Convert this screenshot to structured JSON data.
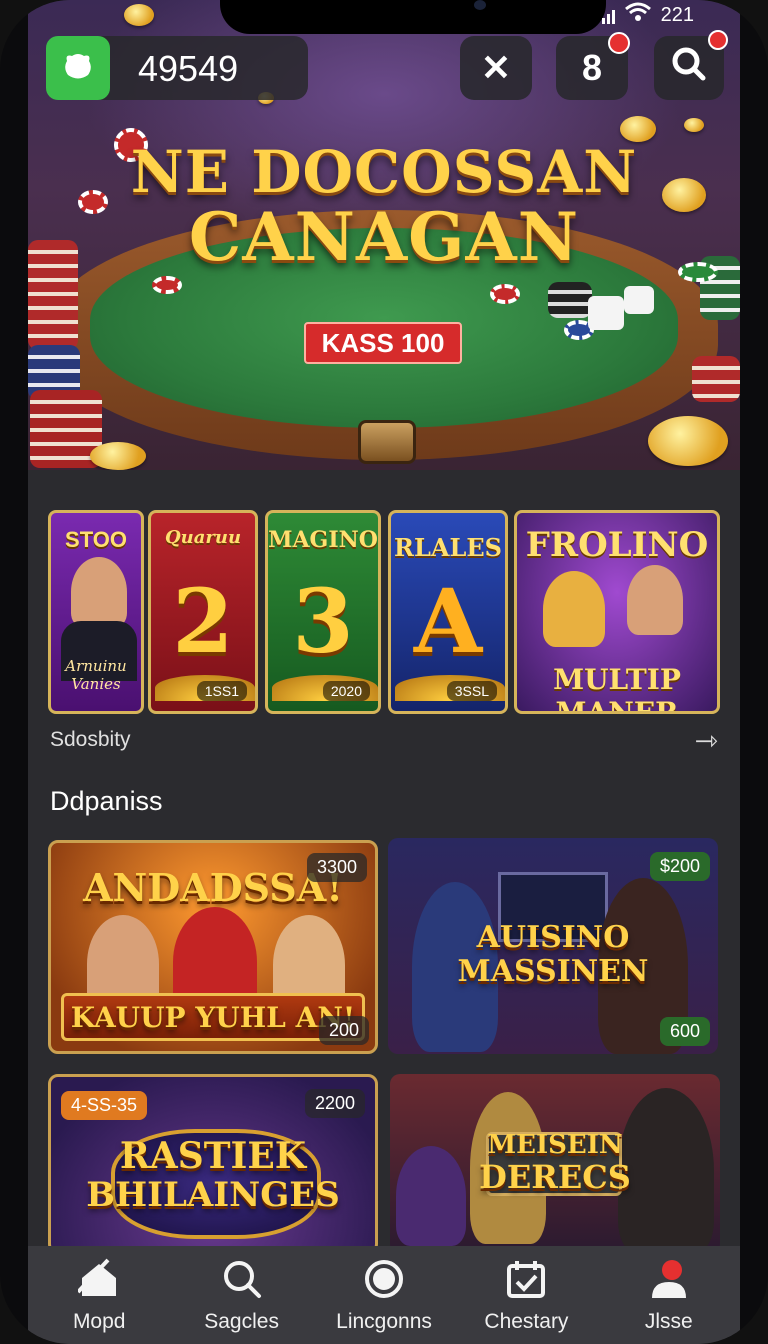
{
  "status_bar": {
    "time": "221"
  },
  "top_bar": {
    "balance": "49549",
    "notifications_count": "8"
  },
  "hero": {
    "title_line1": "NE DOCOSSAN",
    "title_line2": "CANAGAN",
    "badge": "KASS 100"
  },
  "game_tiles": [
    {
      "title": "STOO",
      "subtitle": "Arnuinu Vanies"
    },
    {
      "title": "Quaruu",
      "big": "2",
      "number": "1SS1"
    },
    {
      "title": "MAGINO",
      "big": "3",
      "number": "2020"
    },
    {
      "title": "RLALES",
      "big": "A",
      "number": "3SSL"
    },
    {
      "title": "FROLINO",
      "subtitle": "MULTIP MANER"
    }
  ],
  "section_link": {
    "label": "Sdosbity"
  },
  "section_title": "Ddpaniss",
  "promo_cards": [
    {
      "headline": "ANDADSSA!",
      "banner": "KAUUP YUHL AN!",
      "top_value": "3300",
      "bottom_value": "200"
    },
    {
      "headline_line1": "AUISINO",
      "headline_line2": "MASSINEN",
      "top_value": "$200",
      "bottom_value": "600"
    },
    {
      "headline_line1": "RASTIEK",
      "headline_line2": "BHILAINGES",
      "tag": "4-SS-35",
      "top_value": "2200"
    },
    {
      "headline_line1": "MEISEIN",
      "headline_line2": "DERECS"
    }
  ],
  "bottom_nav": [
    {
      "label": "Mopd",
      "icon": "home-icon"
    },
    {
      "label": "Sagcles",
      "icon": "search-icon"
    },
    {
      "label": "Lincgonns",
      "icon": "circle-icon"
    },
    {
      "label": "Chestary",
      "icon": "calendar-check-icon"
    },
    {
      "label": "Jlsse",
      "icon": "profile-icon"
    }
  ],
  "colors": {
    "accent_green": "#3bbf4b",
    "badge_red": "#d62b2b",
    "gold": "#ffd24a",
    "nav_bg": "#3a3a3f",
    "screen_bg": "#2b2b2f"
  }
}
